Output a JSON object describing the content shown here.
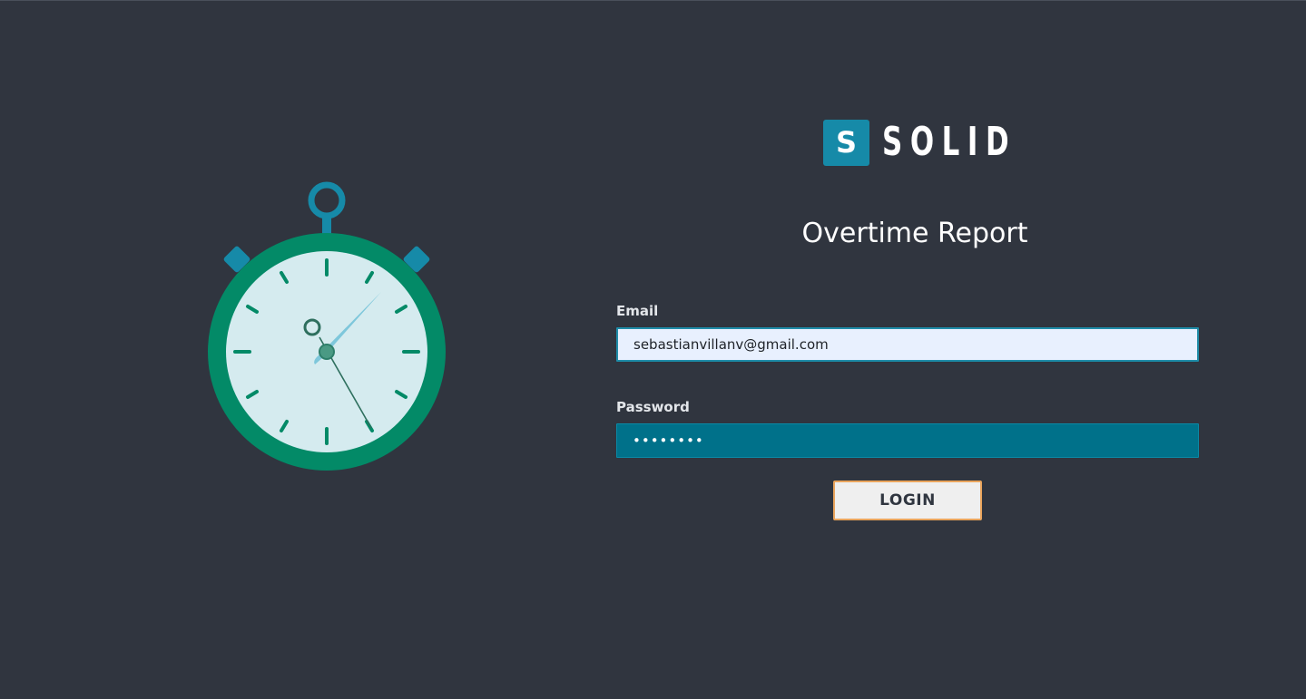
{
  "brand": {
    "logo_letter": "S",
    "logo_word": "SOLID"
  },
  "page": {
    "title": "Overtime Report"
  },
  "login_form": {
    "email_label": "Email",
    "email_value": "sebastianvillanv@gmail.com",
    "password_label": "Password",
    "password_masked": "••••••••",
    "login_button_label": "LOGIN"
  },
  "icons": {
    "illustration": "stopwatch-icon"
  },
  "colors": {
    "background": "#30353f",
    "brand_accent": "#168aa8",
    "stopwatch_body": "#038a67",
    "stopwatch_face": "#d5ebef",
    "password_field": "#00718a",
    "email_field": "#e8f0fe",
    "button_border": "#e9a45c"
  }
}
